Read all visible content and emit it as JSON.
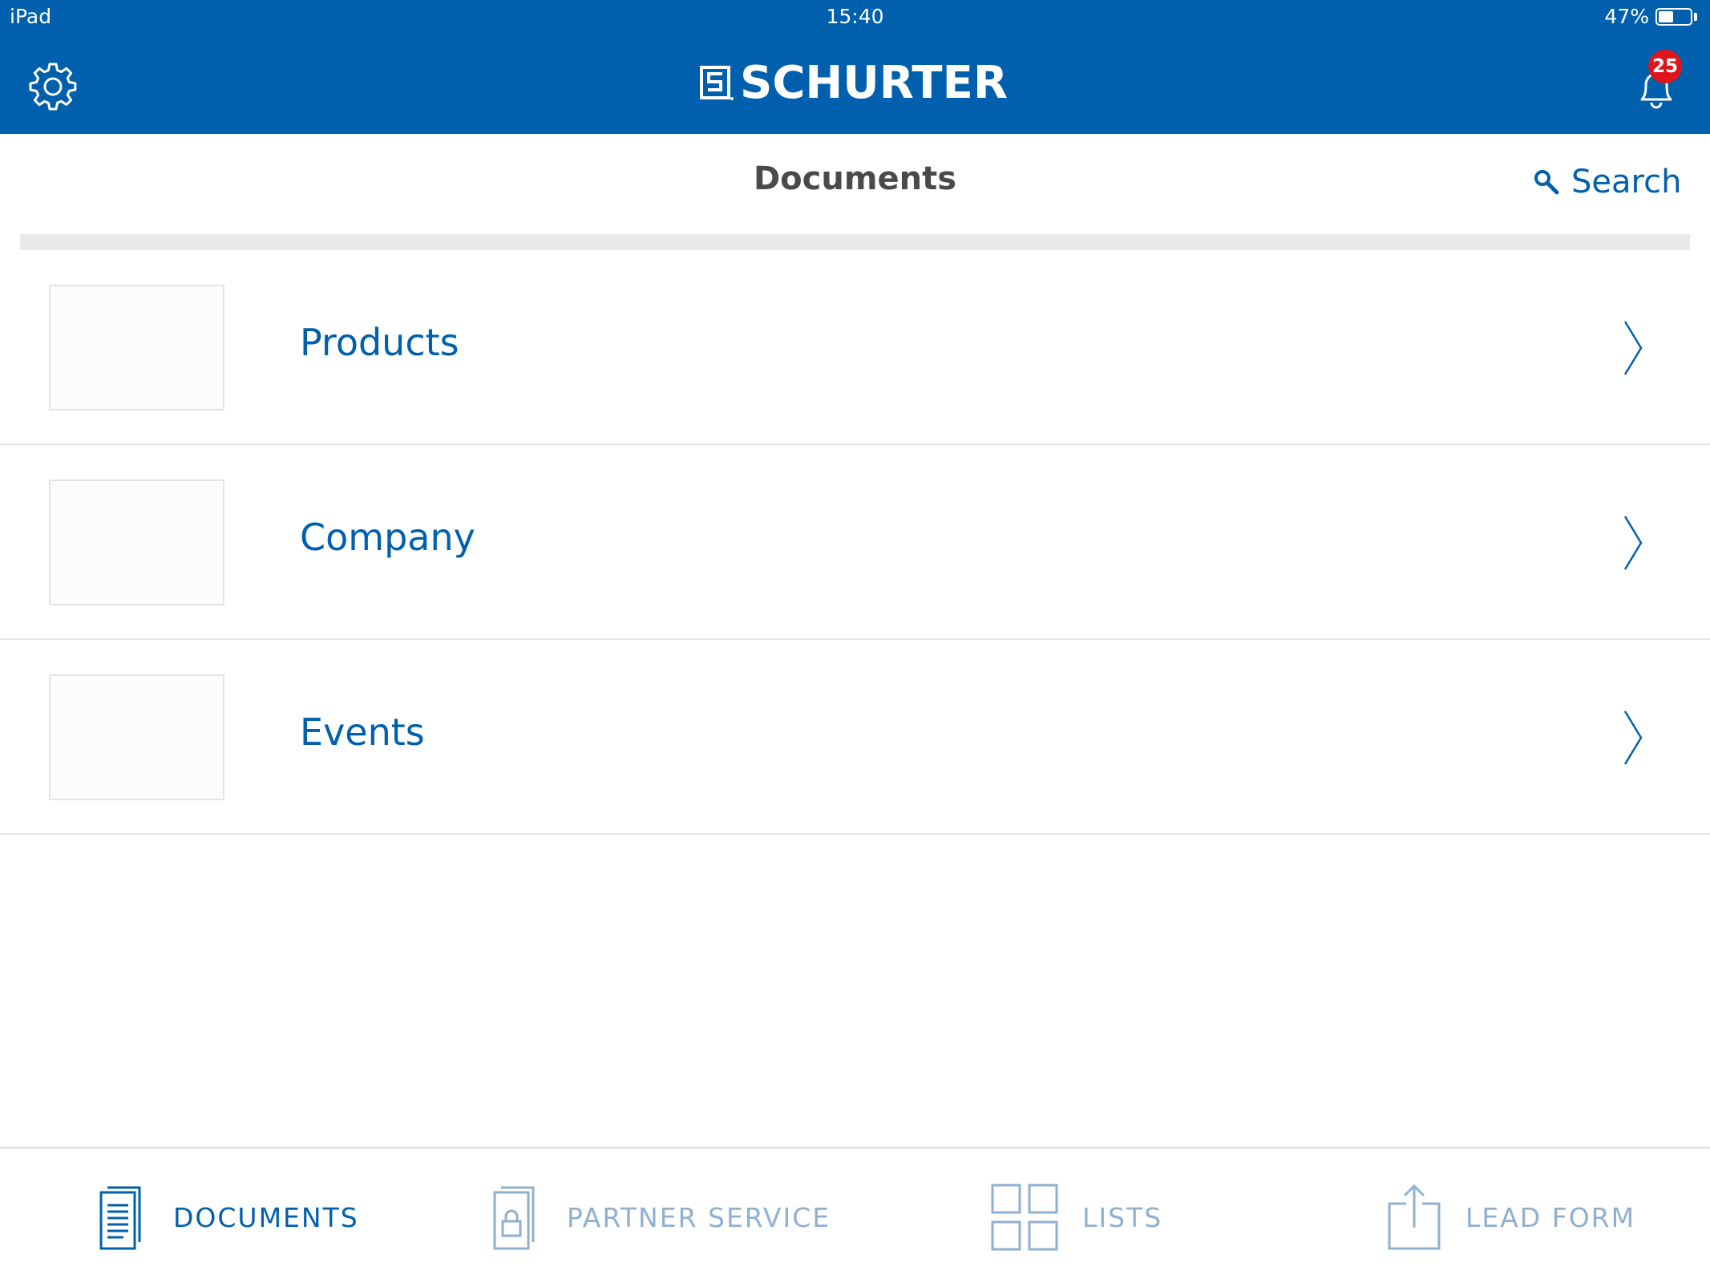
{
  "status_bar": {
    "device": "iPad",
    "time": "15:40",
    "battery": "47%",
    "battery_level": 0.47
  },
  "header": {
    "brand": "SCHURTER",
    "notification_count": "25"
  },
  "page": {
    "title": "Documents",
    "search_label": "Search"
  },
  "items": [
    {
      "label": "Products"
    },
    {
      "label": "Company"
    },
    {
      "label": "Events"
    }
  ],
  "tabs": [
    {
      "label": "DOCUMENTS",
      "icon": "documents-icon",
      "active": true
    },
    {
      "label": "PARTNER SERVICE",
      "icon": "locked-document-icon",
      "active": false
    },
    {
      "label": "LISTS",
      "icon": "grid-icon",
      "active": false
    },
    {
      "label": "LEAD FORM",
      "icon": "share-icon",
      "active": false
    }
  ],
  "colors": {
    "brand_blue": "#0160ad",
    "badge_red": "#e0141c",
    "inactive_tab": "#8fb0d1",
    "title_gray": "#4a4a4a"
  }
}
